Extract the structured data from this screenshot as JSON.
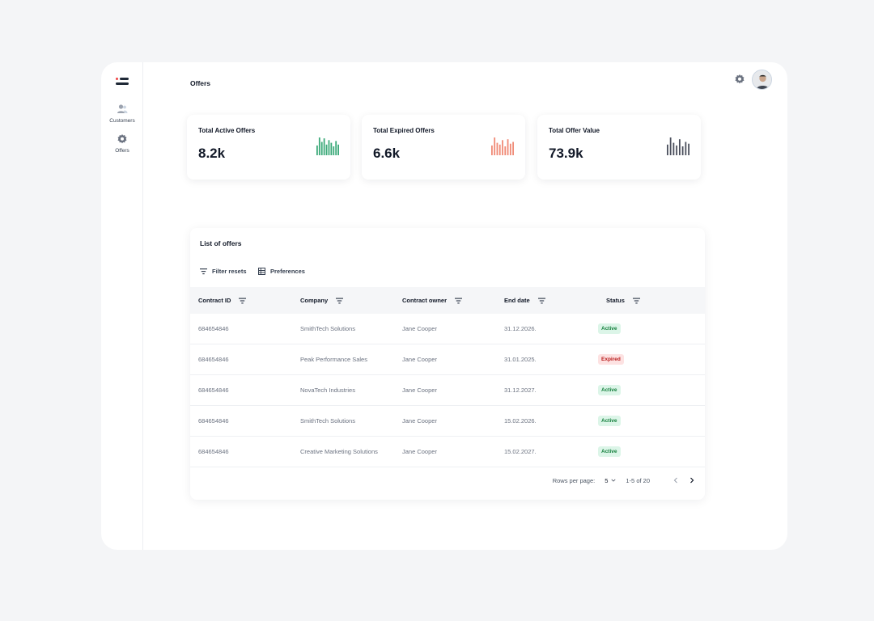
{
  "sidebar": {
    "items": [
      {
        "label": "Customers",
        "icon": "users-icon"
      },
      {
        "label": "Offers",
        "icon": "gear-icon"
      }
    ]
  },
  "header": {
    "title": "Offers",
    "settings_icon": "settings-icon",
    "avatar_icon": "user-avatar"
  },
  "stats": [
    {
      "label": "Total Active Offers",
      "value": "8.2k",
      "color": "#3daa7a",
      "bars": [
        0.55,
        1.0,
        0.75,
        0.95,
        0.6,
        0.85,
        0.7,
        0.5,
        0.8,
        0.6
      ]
    },
    {
      "label": "Total Expired Offers",
      "value": "6.6k",
      "color": "#f08a76",
      "bars": [
        0.55,
        1.0,
        0.7,
        0.6,
        0.85,
        0.5,
        0.9,
        0.65,
        0.75
      ]
    },
    {
      "label": "Total Offer Value",
      "value": "73.9k",
      "color": "#4b4f5c",
      "bars": [
        0.6,
        1.0,
        0.7,
        0.55,
        0.9,
        0.5,
        0.75,
        0.65
      ]
    }
  ],
  "table": {
    "title": "List of offers",
    "tools": {
      "filter": "Filter resets",
      "preferences": "Preferences"
    },
    "columns": [
      "Contract ID",
      "Company",
      "Contract owner",
      "End date",
      "Status"
    ],
    "rows": [
      {
        "id": "684654846",
        "company": "SmithTech Solutions",
        "owner": "Jane Cooper",
        "end": "31.12.2026.",
        "status": "Active"
      },
      {
        "id": "684654846",
        "company": "Peak Performance Sales",
        "owner": "Jane Cooper",
        "end": "31.01.2025.",
        "status": "Expired"
      },
      {
        "id": "684654846",
        "company": "NovaTech Industries",
        "owner": "Jane Cooper",
        "end": "31.12.2027.",
        "status": "Active"
      },
      {
        "id": "684654846",
        "company": "SmithTech Solutions",
        "owner": "Jane Cooper",
        "end": "15.02.2026.",
        "status": "Active"
      },
      {
        "id": "684654846",
        "company": "Creative Marketing Solutions",
        "owner": "Jane Cooper",
        "end": "15.02.2027.",
        "status": "Active"
      }
    ],
    "pagination": {
      "rows_label": "Rows per page:",
      "rows_value": "5",
      "range": "1-5 of 20"
    }
  }
}
